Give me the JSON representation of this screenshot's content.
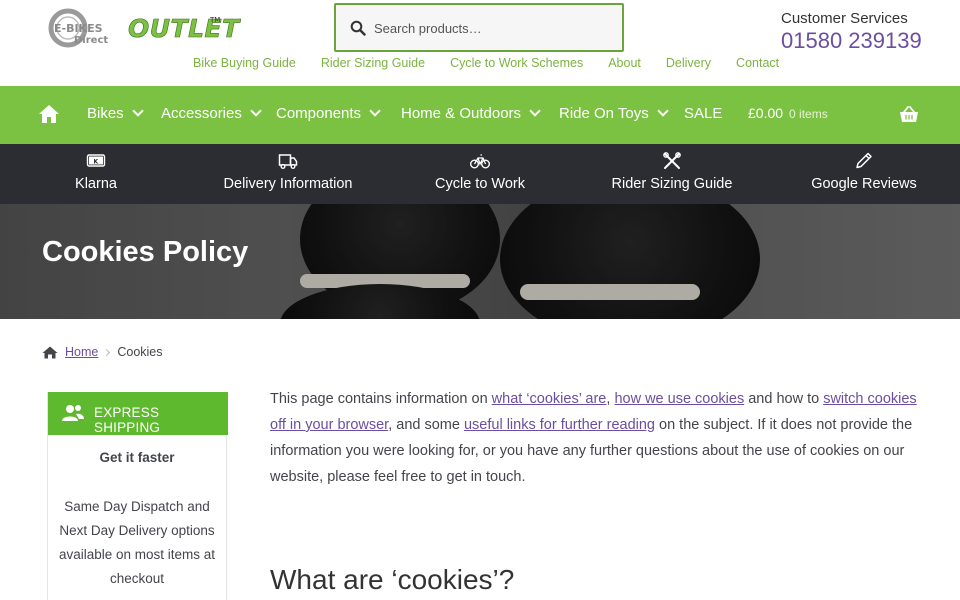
{
  "header": {
    "logo_brand": "E-BIKES Direct",
    "logo_outlet": "OUTLET",
    "logo_tm": "TM",
    "search_placeholder": "Search products…",
    "customer_services_label": "Customer Services",
    "customer_services_phone": "01580 239139",
    "top_links": [
      "Bike Buying Guide",
      "Rider Sizing Guide",
      "Cycle to Work Schemes",
      "About",
      "Delivery",
      "Contact"
    ]
  },
  "nav": {
    "items": [
      {
        "label": "Bikes",
        "dropdown": true
      },
      {
        "label": "Accessories",
        "dropdown": true
      },
      {
        "label": "Components",
        "dropdown": true
      },
      {
        "label": "Home & Outdoors",
        "dropdown": true
      },
      {
        "label": "Ride On Toys",
        "dropdown": true
      },
      {
        "label": "SALE",
        "dropdown": false
      }
    ],
    "cart_total": "£0.00",
    "cart_items": "0 items"
  },
  "info_bar": {
    "items": [
      {
        "label": "Klarna",
        "icon": "klarna-card-icon"
      },
      {
        "label": "Delivery Information",
        "icon": "truck-icon"
      },
      {
        "label": "Cycle to Work",
        "icon": "bicycle-icon"
      },
      {
        "label": "Rider Sizing Guide",
        "icon": "tools-icon"
      },
      {
        "label": "Google Reviews",
        "icon": "pencil-icon"
      }
    ]
  },
  "hero": {
    "title": "Cookies Policy"
  },
  "breadcrumb": {
    "home": "Home",
    "current": "Cookies"
  },
  "sidebar": {
    "badge_title": "EXPRESS SHIPPING",
    "subtitle": "Get it faster",
    "body": "Same Day Dispatch and Next Day Delivery options available on most items at checkout"
  },
  "content": {
    "p1_a": "This page contains information on ",
    "link1": "what ‘cookies’ are",
    "p1_b": ", ",
    "link2": "how we use cookies",
    "p1_c": " and how to ",
    "link3": "switch cookies off in your browser",
    "p1_d": ", and some ",
    "link4": "useful links for further reading",
    "p1_e": " on the subject. If it does not provide the information you were looking for, or you have any further questions about the use of cookies on our website, please feel free to get in touch.",
    "heading": "What are ‘cookies’?"
  },
  "colors": {
    "brand_green": "#7cc242",
    "dark_bar": "#2c2d33",
    "link_purple": "#6b4ea0"
  }
}
